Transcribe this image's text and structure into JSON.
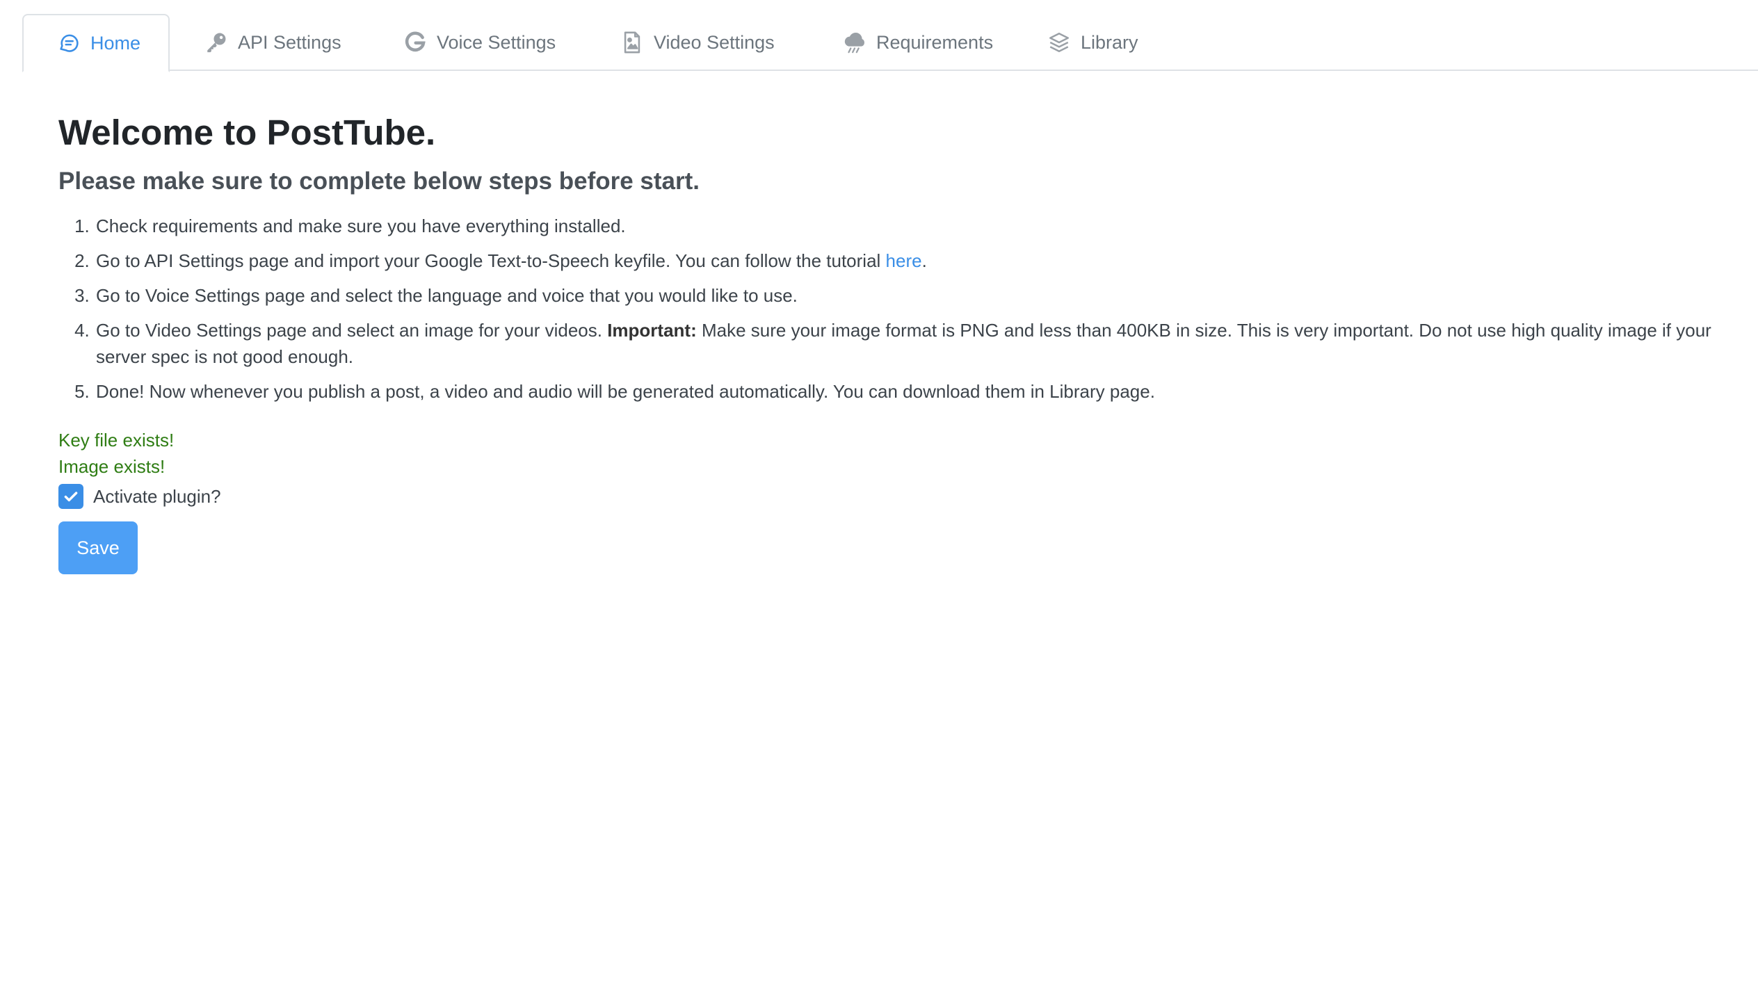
{
  "tabs": [
    {
      "label": "Home",
      "icon": "chat-bubble-icon",
      "active": true
    },
    {
      "label": "API Settings",
      "icon": "key-icon",
      "active": false
    },
    {
      "label": "Voice Settings",
      "icon": "google-icon",
      "active": false
    },
    {
      "label": "Video Settings",
      "icon": "image-file-icon",
      "active": false
    },
    {
      "label": "Requirements",
      "icon": "cloud-icon",
      "active": false
    },
    {
      "label": "Library",
      "icon": "layers-icon",
      "active": false
    }
  ],
  "main": {
    "title": "Welcome to PostTube.",
    "subtitle": "Please make sure to complete below steps before start.",
    "steps": [
      {
        "text": "Check requirements and make sure you have everything installed."
      },
      {
        "text_before": "Go to API Settings page and import your Google Text-to-Speech keyfile. You can follow the tutorial ",
        "link": "here",
        "text_after": "."
      },
      {
        "text": "Go to Voice Settings page and select the language and voice that you would like to use."
      },
      {
        "text_before": "Go to Video Settings page and select an image for your videos. ",
        "bold": "Important:",
        "text_after": " Make sure your image format is PNG and less than 400KB in size. This is very important. Do not use high quality image if your server spec is not good enough."
      },
      {
        "text": "Done! Now whenever you publish a post, a video and audio will be generated automatically. You can download them in Library page."
      }
    ],
    "status_key": "Key file exists!",
    "status_image": "Image exists!",
    "activate_label": "Activate plugin?",
    "activate_checked": true,
    "save_label": "Save"
  },
  "colors": {
    "accent": "#3a8ee6",
    "success": "#2f7d14",
    "button": "#4d9ff5"
  }
}
